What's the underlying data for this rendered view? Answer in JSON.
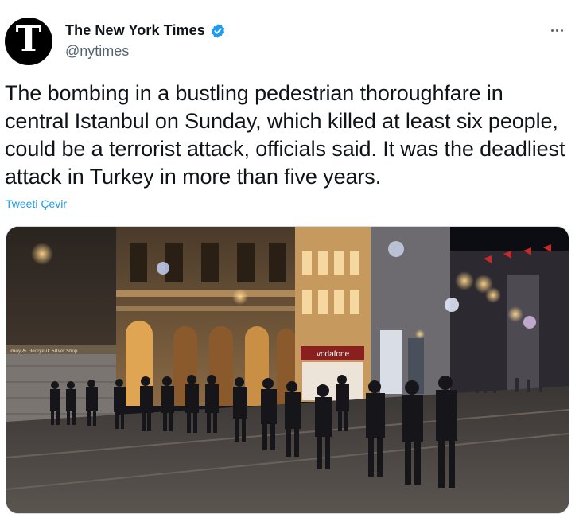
{
  "account": {
    "display_name": "The New York Times",
    "handle": "@nytimes",
    "avatar_letter": "T",
    "verified": true
  },
  "tweet": {
    "text": "The bombing in a bustling pedestrian thoroughfare in central Istanbul on Sunday, which killed at least six people, could be a terrorist attack, officials said. It was the deadliest attack in Turkey in more than five years.",
    "translate_label": "Tweeti Çevir"
  },
  "media": {
    "signs": {
      "left_shop": "imoy & Hediyelik Silver Shop",
      "vodafone": "vodafone"
    }
  },
  "colors": {
    "link": "#1d9bf0",
    "verified": "#1d9bf0",
    "muted": "#536471",
    "text": "#0f1419"
  },
  "icons": {
    "verified": "verified-badge-icon",
    "more": "more-options-icon"
  }
}
